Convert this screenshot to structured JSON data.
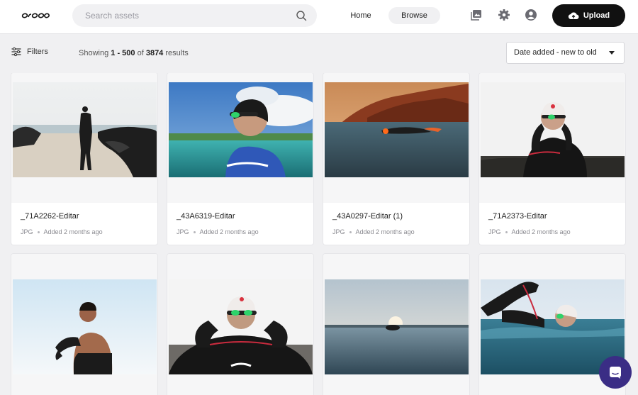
{
  "header": {
    "search_placeholder": "Search assets",
    "nav_home": "Home",
    "nav_browse": "Browse",
    "upload_label": "Upload"
  },
  "toolbar": {
    "filters_label": "Filters",
    "showing_prefix": "Showing",
    "range": "1 - 500",
    "of_text": "of",
    "total": "3874",
    "results_suffix": "results",
    "sort_value": "Date added - new to old"
  },
  "colors": {
    "upload_bg": "#111111",
    "chat_bg": "#3a2d85"
  },
  "assets": [
    {
      "name": "_71A2262-Editar",
      "type": "JPG",
      "added": "Added 2 months ago"
    },
    {
      "name": "_43A6319-Editar",
      "type": "JPG",
      "added": "Added 2 months ago"
    },
    {
      "name": "_43A0297-Editar (1)",
      "type": "JPG",
      "added": "Added 2 months ago"
    },
    {
      "name": "_71A2373-Editar",
      "type": "JPG",
      "added": "Added 2 months ago"
    }
  ]
}
